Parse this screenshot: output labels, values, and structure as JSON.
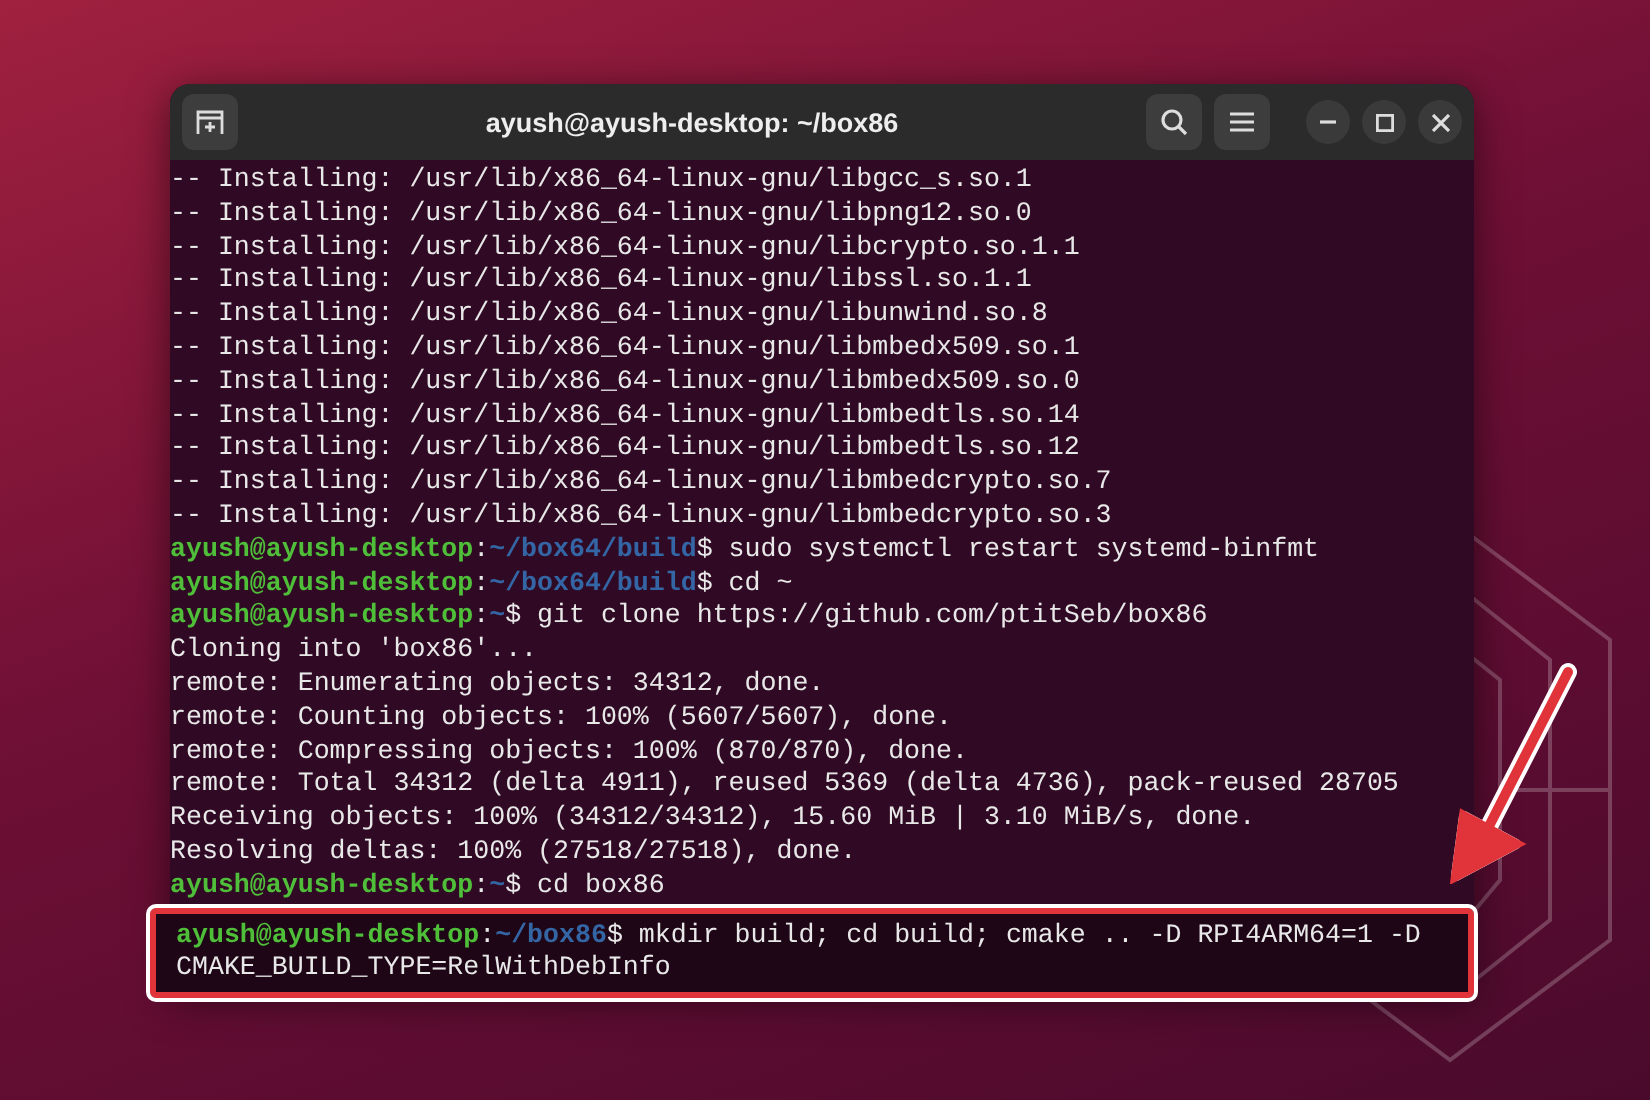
{
  "window": {
    "title": "ayush@ayush-desktop: ~/box86"
  },
  "terminal": {
    "lines": [
      {
        "kind": "output",
        "text": "-- Installing: /usr/lib/x86_64-linux-gnu/libgcc_s.so.1",
        "highlighted": false
      },
      {
        "kind": "output",
        "text": "-- Installing: /usr/lib/x86_64-linux-gnu/libpng12.so.0",
        "highlighted": false
      },
      {
        "kind": "output",
        "text": "-- Installing: /usr/lib/x86_64-linux-gnu/libcrypto.so.1.1",
        "highlighted": false
      },
      {
        "kind": "output",
        "text": "-- Installing: /usr/lib/x86_64-linux-gnu/libssl.so.1.1",
        "highlighted": false
      },
      {
        "kind": "output",
        "text": "-- Installing: /usr/lib/x86_64-linux-gnu/libunwind.so.8",
        "highlighted": false
      },
      {
        "kind": "output",
        "text": "-- Installing: /usr/lib/x86_64-linux-gnu/libmbedx509.so.1",
        "highlighted": false
      },
      {
        "kind": "output",
        "text": "-- Installing: /usr/lib/x86_64-linux-gnu/libmbedx509.so.0",
        "highlighted": false
      },
      {
        "kind": "output",
        "text": "-- Installing: /usr/lib/x86_64-linux-gnu/libmbedtls.so.14",
        "highlighted": false
      },
      {
        "kind": "output",
        "text": "-- Installing: /usr/lib/x86_64-linux-gnu/libmbedtls.so.12",
        "highlighted": false
      },
      {
        "kind": "output",
        "text": "-- Installing: /usr/lib/x86_64-linux-gnu/libmbedcrypto.so.7",
        "highlighted": false
      },
      {
        "kind": "output",
        "text": "-- Installing: /usr/lib/x86_64-linux-gnu/libmbedcrypto.so.3",
        "highlighted": false
      },
      {
        "kind": "prompt",
        "user": "ayush@ayush-desktop",
        "separator": ":",
        "path": "~/box64/build",
        "command": "$ sudo systemctl restart systemd-binfmt",
        "highlighted": false
      },
      {
        "kind": "prompt",
        "user": "ayush@ayush-desktop",
        "separator": ":",
        "path": "~/box64/build",
        "command": "$ cd ~",
        "highlighted": false
      },
      {
        "kind": "prompt",
        "user": "ayush@ayush-desktop",
        "separator": ":",
        "path": "~",
        "command": "$ git clone https://github.com/ptitSeb/box86",
        "highlighted": false
      },
      {
        "kind": "output",
        "text": "Cloning into 'box86'...",
        "highlighted": false
      },
      {
        "kind": "output",
        "text": "remote: Enumerating objects: 34312, done.",
        "highlighted": false
      },
      {
        "kind": "output",
        "text": "remote: Counting objects: 100% (5607/5607), done.",
        "highlighted": false
      },
      {
        "kind": "output",
        "text": "remote: Compressing objects: 100% (870/870), done.",
        "highlighted": false
      },
      {
        "kind": "output",
        "text": "remote: Total 34312 (delta 4911), reused 5369 (delta 4736), pack-reused 28705",
        "highlighted": false
      },
      {
        "kind": "output",
        "text": "Receiving objects: 100% (34312/34312), 15.60 MiB | 3.10 MiB/s, done.",
        "highlighted": false
      },
      {
        "kind": "output",
        "text": "Resolving deltas: 100% (27518/27518), done.",
        "highlighted": false
      },
      {
        "kind": "prompt",
        "user": "ayush@ayush-desktop",
        "separator": ":",
        "path": "~",
        "command": "$ cd box86",
        "highlighted": false
      },
      {
        "kind": "prompt",
        "user": "ayush@ayush-desktop",
        "separator": ":",
        "path": "~/box86",
        "command": "$ mkdir build; cd build; cmake .. -D RPI4ARM64=1 -D CMAKE_BUILD_TYPE=RelWithDebInfo",
        "highlighted": true
      }
    ]
  }
}
